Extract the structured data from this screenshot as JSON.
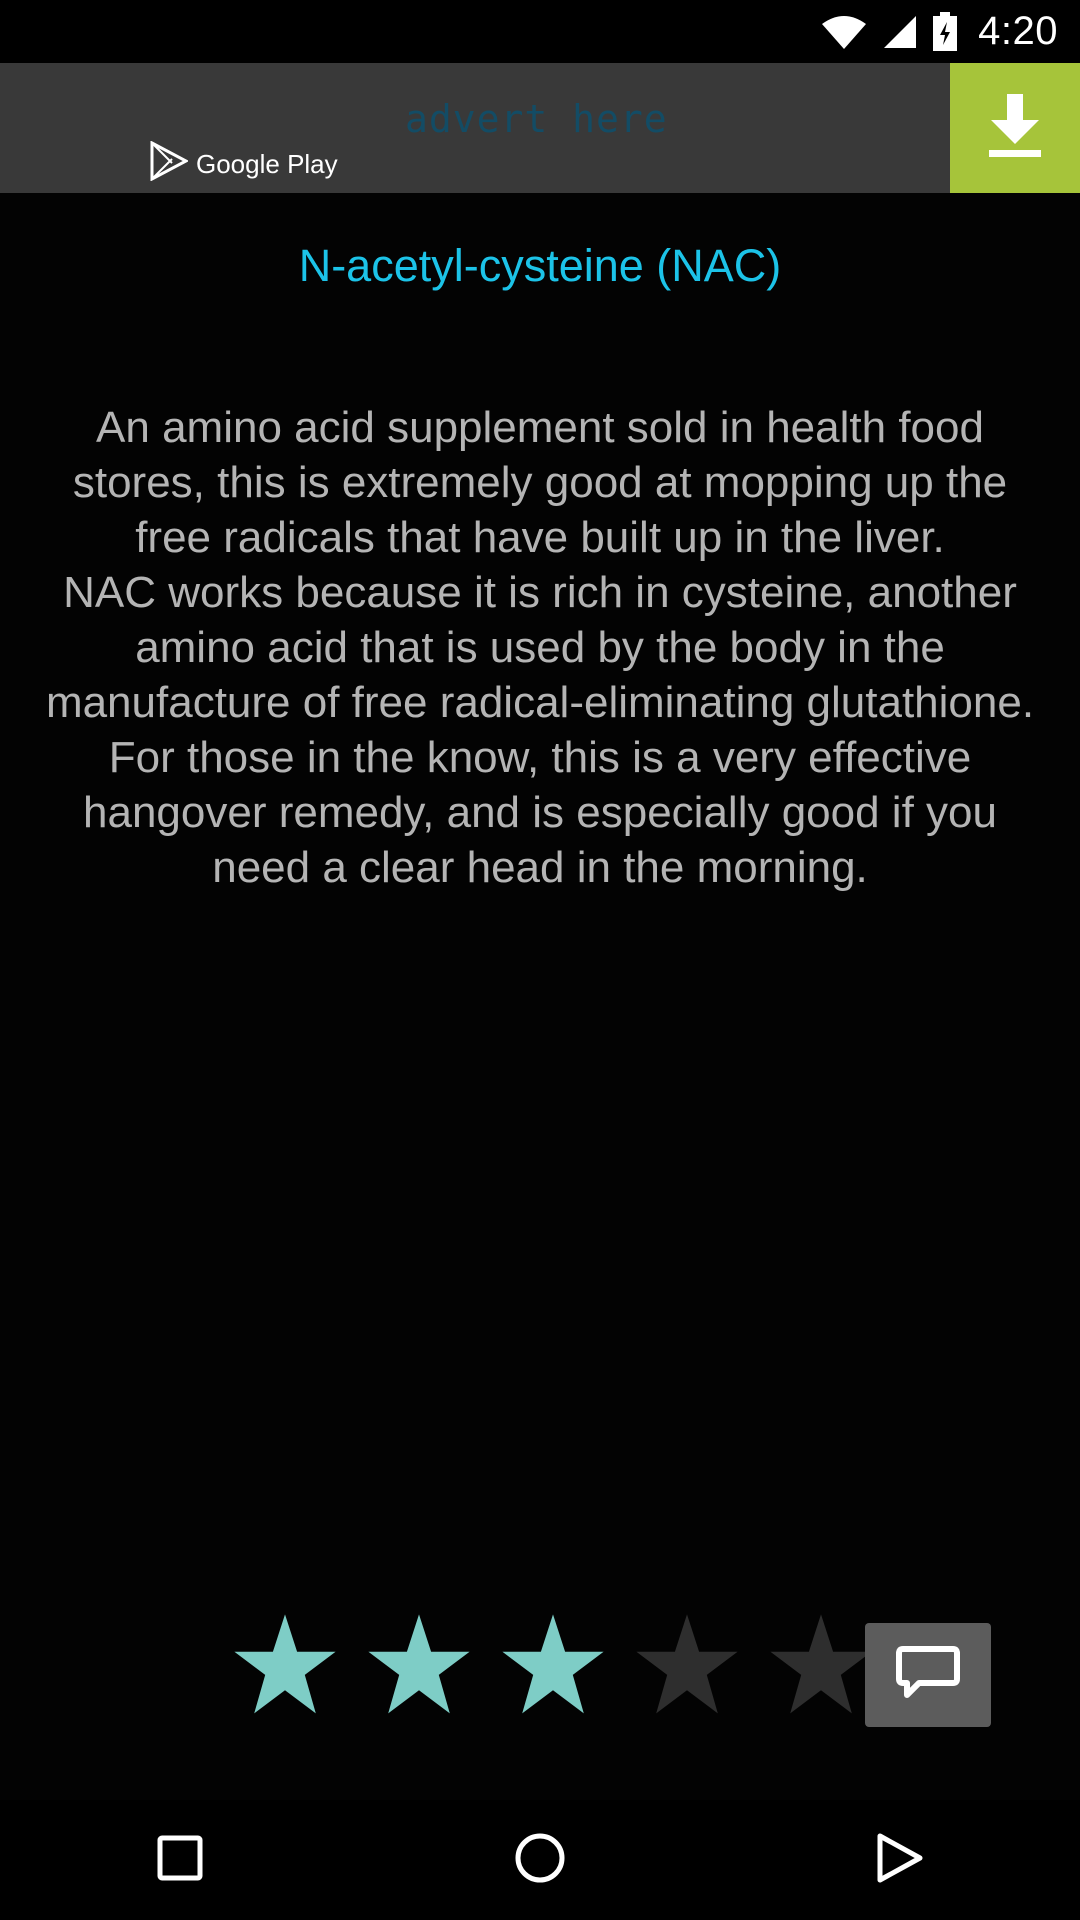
{
  "status_bar": {
    "time": "4:20",
    "icons": [
      "wifi-icon",
      "signal-icon",
      "battery-icon"
    ]
  },
  "ad": {
    "store_label": "Google Play",
    "placeholder_text": "advert here",
    "download_icon": "download-icon",
    "colors": {
      "banner_bg": "#393939",
      "download_bg": "#a6c43a",
      "ad_text": "#0f4f6a"
    }
  },
  "article": {
    "title": "N-acetyl-cysteine (NAC)",
    "body": "An amino acid supplement sold in health food stores, this is extremely good at mopping up the free radicals that have built up in the liver.\n NAC works because it is rich in cysteine, another amino acid that is used by the body in the manufacture of free radical-eliminating glutathione.\n For those in the know, this is a very effective hangover remedy, and is especially good if you need a clear head in the morning.",
    "colors": {
      "title": "#1cc3e8",
      "body": "#b4b4b4"
    }
  },
  "rating": {
    "value": 3,
    "max": 5,
    "colors": {
      "filled": "#7ecdc6",
      "empty": "#2e2e2e"
    }
  },
  "comment_button": {
    "icon": "comment-icon"
  },
  "nav_bar": {
    "buttons": [
      "recents-icon",
      "home-icon",
      "back-icon"
    ]
  }
}
